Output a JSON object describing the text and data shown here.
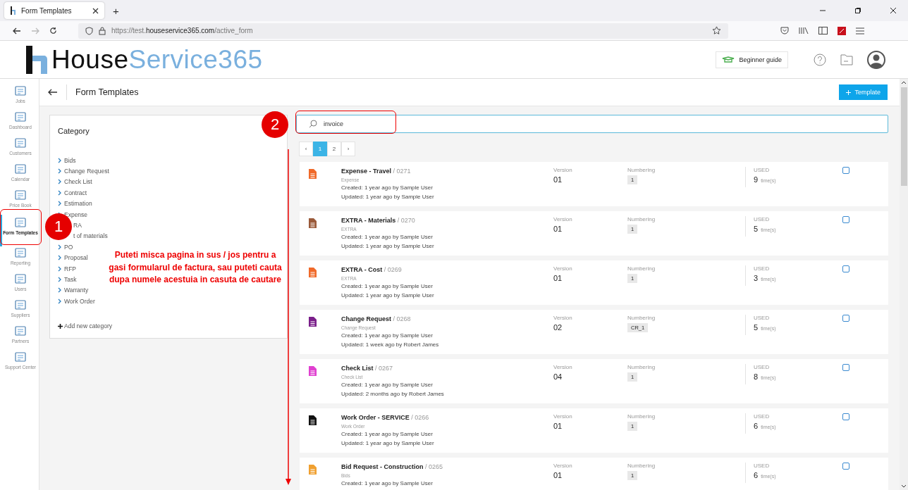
{
  "browser": {
    "tab_title": "Form Templates",
    "new_tab": "+",
    "url": "https://test.**houseservice365.com**/active_form"
  },
  "header": {
    "logo_dark": "House",
    "logo_light": "Service365",
    "guide_button": "Beginner guide"
  },
  "sidebar": {
    "items": [
      {
        "label": "Jobs",
        "selected": false
      },
      {
        "label": "Dashboard",
        "selected": false
      },
      {
        "label": "Customers",
        "selected": false
      },
      {
        "label": "Calendar",
        "selected": false
      },
      {
        "label": "Price Book",
        "selected": false
      },
      {
        "label": "Form Templates",
        "selected": true
      },
      {
        "label": "Reporting",
        "selected": false
      },
      {
        "label": "Users",
        "selected": false
      },
      {
        "label": "Suppliers",
        "selected": false
      },
      {
        "label": "Partners",
        "selected": false
      },
      {
        "label": "Support Center",
        "selected": false
      }
    ]
  },
  "page": {
    "title": "Form Templates",
    "add_button": "Template"
  },
  "category_panel": {
    "title": "Category",
    "items": [
      {
        "label": "Bids",
        "kind": "normal"
      },
      {
        "label": "Change Request",
        "kind": "normal"
      },
      {
        "label": "Check List",
        "kind": "normal"
      },
      {
        "label": "Contract",
        "kind": "normal"
      },
      {
        "label": "Estimation",
        "kind": "normal"
      },
      {
        "label": "Expense",
        "kind": "normal"
      },
      {
        "label": "RA",
        "kind": "covered"
      },
      {
        "label": "t of materials",
        "kind": "covered"
      },
      {
        "label": "PO",
        "kind": "normal"
      },
      {
        "label": "Proposal",
        "kind": "normal"
      },
      {
        "label": "RFP",
        "kind": "normal"
      },
      {
        "label": "Task",
        "kind": "normal"
      },
      {
        "label": "Warranty",
        "kind": "normal"
      },
      {
        "label": "Work Order",
        "kind": "normal"
      }
    ],
    "add_link": "Add new category"
  },
  "search": {
    "value": "invoice"
  },
  "pagination": {
    "prev": "‹",
    "next": "›",
    "pages": [
      {
        "label": "1",
        "selected": true
      },
      {
        "label": "2",
        "selected": false
      }
    ]
  },
  "templates": [
    {
      "title": "Expense - Travel",
      "code": "/ 0271",
      "category": "Expense",
      "created": "Created: 1 year ago by Sample User",
      "updated": "Updated: 1 year ago by Sample User",
      "version_label": "Version",
      "version": "01",
      "numbering_label": "Numbering",
      "numbering": "1",
      "used_label": "USED",
      "used": "9",
      "times": "time(s)",
      "color": "#f06a2a",
      "checked": false
    },
    {
      "title": "EXTRA - Materials",
      "code": "/ 0270",
      "category": "EXTRA",
      "created": "Created: 1 year ago by Sample User",
      "updated": "Updated: 1 year ago by Sample User",
      "version_label": "Version",
      "version": "01",
      "numbering_label": "Numbering",
      "numbering": "1",
      "used_label": "USED",
      "used": "5",
      "times": "time(s)",
      "color": "#9a5a3a",
      "checked": false
    },
    {
      "title": "EXTRA - Cost",
      "code": "/ 0269",
      "category": "EXTRA",
      "created": "Created: 1 year ago by Sample User",
      "updated": "Updated: 1 year ago by Sample User",
      "version_label": "Version",
      "version": "01",
      "numbering_label": "Numbering",
      "numbering": "1",
      "used_label": "USED",
      "used": "3",
      "times": "time(s)",
      "color": "#f06a2a",
      "checked": false
    },
    {
      "title": "Change Request",
      "code": "/ 0268",
      "category": "Change Request",
      "created": "Created: 1 year ago by Sample User",
      "updated": "Updated: 1 week ago by Robert James",
      "version_label": "Version",
      "version": "02",
      "numbering_label": "Numbering",
      "numbering": "CR_1",
      "used_label": "USED",
      "used": "5",
      "times": "time(s)",
      "color": "#7a1f8a",
      "checked": false
    },
    {
      "title": "Check List",
      "code": "/ 0267",
      "category": "Check List",
      "created": "Created: 1 year ago by Sample User",
      "updated": "Updated: 2 months ago by Robert James",
      "version_label": "Version",
      "version": "04",
      "numbering_label": "Numbering",
      "numbering": "1",
      "used_label": "USED",
      "used": "8",
      "times": "time(s)",
      "color": "#e040d0",
      "checked": false
    },
    {
      "title": "Work Order - SERVICE",
      "code": "/ 0266",
      "category": "Work Order",
      "created": "Created: 1 year ago by Sample User",
      "updated": "Updated: 1 year ago by Sample User",
      "version_label": "Version",
      "version": "01",
      "numbering_label": "Numbering",
      "numbering": "1",
      "used_label": "USED",
      "used": "6",
      "times": "time(s)",
      "color": "#111111",
      "checked": false
    },
    {
      "title": "Bid Request - Construction",
      "code": "/ 0265",
      "category": "Bids",
      "created": "Created: 1 year ago by Sample User",
      "version_label": "Version",
      "version": "01",
      "numbering_label": "Numbering",
      "numbering": "1",
      "used_label": "USED",
      "used": "6",
      "times": "time(s)",
      "color": "#f0a030",
      "checked": false
    }
  ],
  "annotations": {
    "markers": [
      {
        "label": "1"
      },
      {
        "label": "2"
      }
    ],
    "note": "Puteti misca pagina in sus / jos pentru a gasi formularul de factura, sau puteti cauta dupa numele acestuia in casuta de cautare"
  }
}
